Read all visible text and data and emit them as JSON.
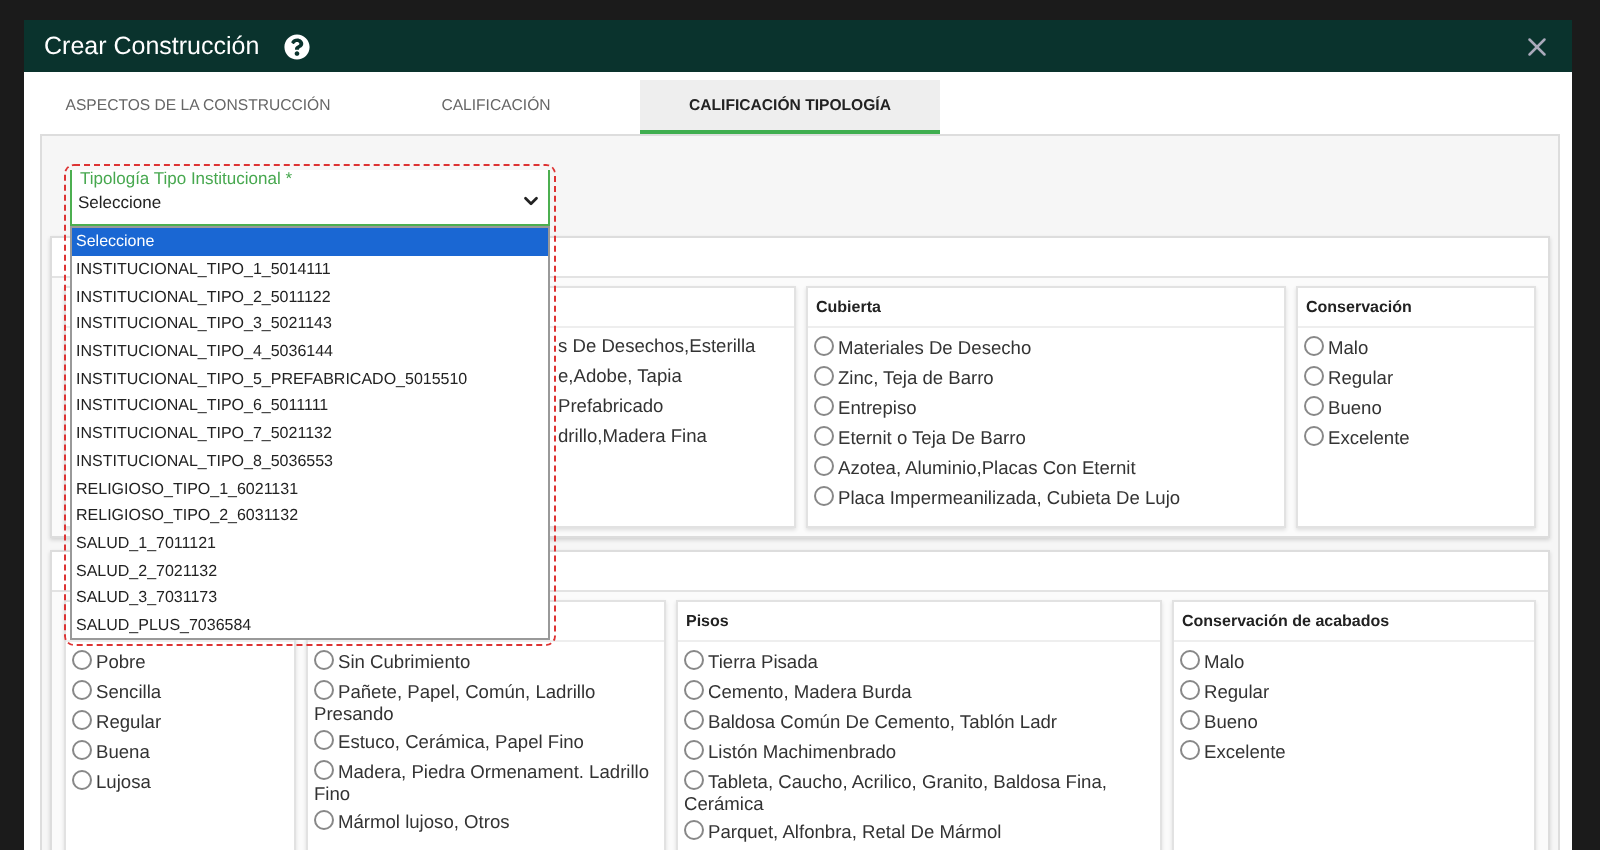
{
  "window": {
    "title": "Crear Construcción"
  },
  "tabs": [
    {
      "label": "ASPECTOS DE LA CONSTRUCCIÓN",
      "selected": false
    },
    {
      "label": "CALIFICACIÓN",
      "selected": false
    },
    {
      "label": "CALIFICACIÓN TIPOLOGÍA",
      "selected": true
    }
  ],
  "field": {
    "label": "Tipología Tipo Institucional *",
    "value": "Seleccione",
    "expanded": true,
    "options": [
      {
        "label": "Seleccione",
        "selected": true
      },
      {
        "label": "INSTITUCIONAL_TIPO_1_5014111",
        "selected": false
      },
      {
        "label": "INSTITUCIONAL_TIPO_2_5011122",
        "selected": false
      },
      {
        "label": "INSTITUCIONAL_TIPO_3_5021143",
        "selected": false
      },
      {
        "label": "INSTITUCIONAL_TIPO_4_5036144",
        "selected": false
      },
      {
        "label": "INSTITUCIONAL_TIPO_5_PREFABRICADO_5015510",
        "selected": false
      },
      {
        "label": "INSTITUCIONAL_TIPO_6_5011111",
        "selected": false
      },
      {
        "label": "INSTITUCIONAL_TIPO_7_5021132",
        "selected": false
      },
      {
        "label": "INSTITUCIONAL_TIPO_8_5036553",
        "selected": false
      },
      {
        "label": "RELIGIOSO_TIPO_1_6021131",
        "selected": false
      },
      {
        "label": "RELIGIOSO_TIPO_2_6031132",
        "selected": false
      },
      {
        "label": "SALUD_1_7011121",
        "selected": false
      },
      {
        "label": "SALUD_2_7021132",
        "selected": false
      },
      {
        "label": "SALUD_3_7031173",
        "selected": false
      },
      {
        "label": "SALUD_PLUS_7036584",
        "selected": false
      }
    ]
  },
  "sections": [
    {
      "groups": [
        {
          "options": [
            {
              "label": "s De Desechos,Esterilla"
            },
            {
              "label": "e,Adobe, Tapia"
            },
            {
              "label": "Prefabricado"
            },
            {
              "label": "drillo,Madera Fina"
            }
          ]
        },
        {
          "title": "Cubierta",
          "options": [
            {
              "label": "Materiales De Desecho",
              "selected": false
            },
            {
              "label": "Zinc, Teja de Barro",
              "selected": false
            },
            {
              "label": "Entrepiso",
              "selected": false
            },
            {
              "label": "Eternit o Teja De Barro",
              "selected": false
            },
            {
              "label": "Azotea, Aluminio,Placas Con Eternit",
              "selected": false
            },
            {
              "label": "Placa Impermeanilizada, Cubieta De Lujo",
              "selected": false
            }
          ]
        },
        {
          "title": "Conservación",
          "options": [
            {
              "label": "Malo",
              "selected": false
            },
            {
              "label": "Regular",
              "selected": false
            },
            {
              "label": "Bueno",
              "selected": false
            },
            {
              "label": "Excelente",
              "selected": false
            }
          ]
        }
      ]
    },
    {
      "groups": [
        {
          "options": [
            {
              "label": "Pobre",
              "selected": false
            },
            {
              "label": "Sencilla",
              "selected": false
            },
            {
              "label": "Regular",
              "selected": false
            },
            {
              "label": "Buena",
              "selected": false
            },
            {
              "label": "Lujosa",
              "selected": false
            }
          ]
        },
        {
          "options": [
            {
              "label": "Sin Cubrimiento",
              "selected": false
            },
            {
              "label": "Pañete, Papel, Común, Ladrillo Presando",
              "selected": false
            },
            {
              "label": "Estuco, Cerámica, Papel Fino",
              "selected": false
            },
            {
              "label": "Madera, Piedra Ormenament. Ladrillo Fino",
              "selected": false
            },
            {
              "label": "Mármol lujoso, Otros",
              "selected": false
            }
          ]
        },
        {
          "title": "Pisos",
          "options": [
            {
              "label": "Tierra Pisada",
              "selected": false
            },
            {
              "label": "Cemento, Madera Burda",
              "selected": false
            },
            {
              "label": "Baldosa Común De Cemento, Tablón Ladr",
              "selected": false
            },
            {
              "label": "Listón Machimenbrado",
              "selected": false
            },
            {
              "label": "Tableta, Caucho, Acrilico, Granito, Baldosa Fina, Cerámica",
              "selected": false
            },
            {
              "label": "Parquet, Alfonbra, Retal De Mármol",
              "selected": false
            }
          ]
        },
        {
          "title": "Conservación de acabados",
          "options": [
            {
              "label": "Malo",
              "selected": false
            },
            {
              "label": "Regular",
              "selected": false
            },
            {
              "label": "Bueno",
              "selected": false
            },
            {
              "label": "Excelente",
              "selected": false
            }
          ]
        }
      ]
    }
  ]
}
